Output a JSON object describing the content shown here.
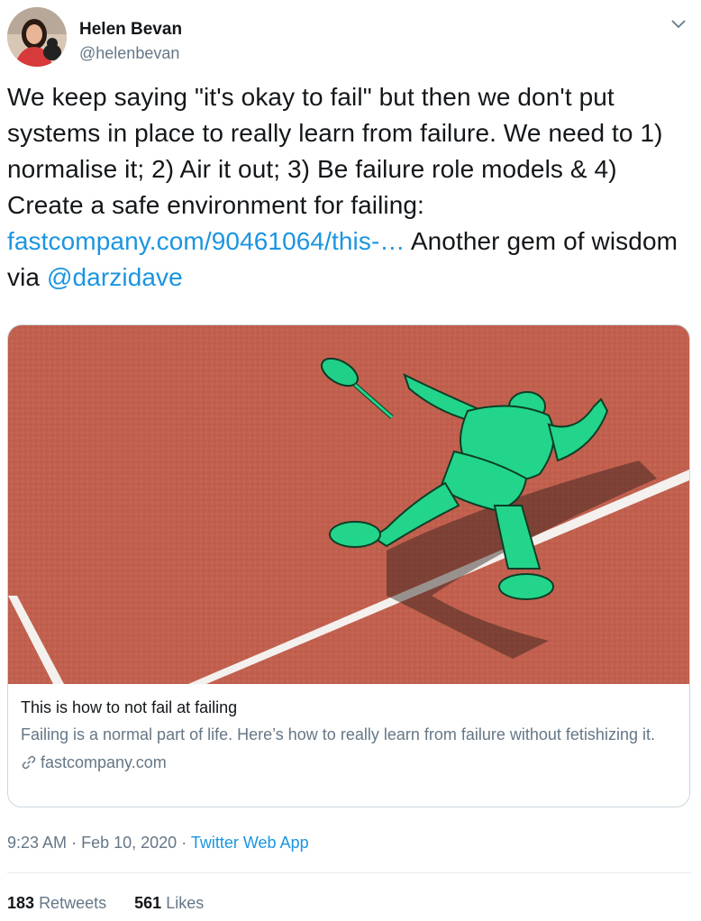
{
  "author": {
    "name": "Helen Bevan",
    "handle": "@helenbevan"
  },
  "tweet": {
    "text_before_link": "We keep saying \"it's okay to fail\" but then we don't put systems in place to really learn from failure. We need to 1) normalise it; 2) Air it out; 3) Be failure role models & 4) Create a safe environment for failing: ",
    "link_text": "fastcompany.com/90461064/this-…",
    "text_middle": " Another gem of wisdom via ",
    "mention": "@darzidave"
  },
  "card": {
    "title": "This is how to not fail at failing",
    "description": "Failing is a normal part of life. Here’s how to really learn from failure without fetishizing it.",
    "domain": "fastcompany.com"
  },
  "meta": {
    "time": "9:23 AM",
    "date": "Feb 10, 2020",
    "separator": "·",
    "source": "Twitter Web App"
  },
  "stats": {
    "retweets_count": "183",
    "retweets_label": "Retweets",
    "likes_count": "561",
    "likes_label": "Likes"
  },
  "colors": {
    "link": "#1b95e0",
    "secondary_text": "#657786",
    "primary_text": "#14171a",
    "court": "#c0604f",
    "figure": "#22d58a"
  },
  "icons": [
    "chevron-down-icon",
    "link-icon"
  ]
}
